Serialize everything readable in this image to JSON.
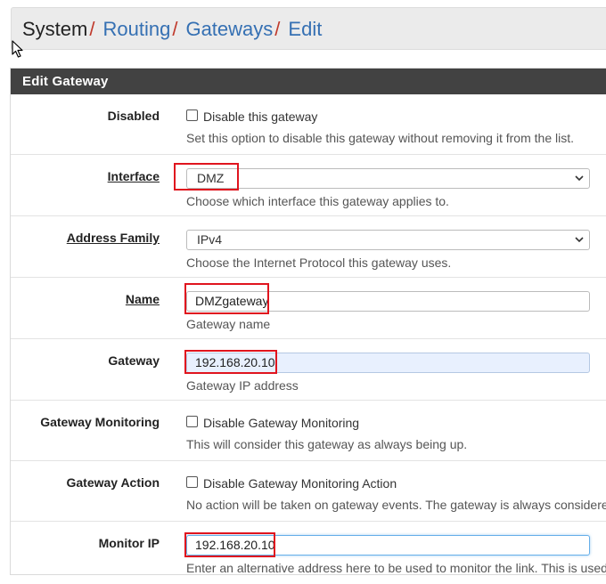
{
  "breadcrumb": {
    "items": [
      "System",
      "Routing",
      "Gateways",
      "Edit"
    ],
    "separator": "/"
  },
  "panel": {
    "title": "Edit Gateway"
  },
  "fields": {
    "disabled": {
      "label": "Disabled",
      "checkbox_label": "Disable this gateway",
      "checked": false,
      "help": "Set this option to disable this gateway without removing it from the list."
    },
    "interface": {
      "label": "Interface",
      "value": "DMZ",
      "help": "Choose which interface this gateway applies to."
    },
    "address_family": {
      "label": "Address Family",
      "value": "IPv4",
      "help": "Choose the Internet Protocol this gateway uses."
    },
    "name": {
      "label": "Name",
      "value": "DMZgateway",
      "help": "Gateway name"
    },
    "gateway": {
      "label": "Gateway",
      "value": "192.168.20.10",
      "help": "Gateway IP address"
    },
    "gateway_monitoring": {
      "label": "Gateway Monitoring",
      "checkbox_label": "Disable Gateway Monitoring",
      "checked": false,
      "help": "This will consider this gateway as always being up."
    },
    "gateway_action": {
      "label": "Gateway Action",
      "checkbox_label": "Disable Gateway Monitoring Action",
      "checked": false,
      "help": "No action will be taken on gateway events. The gateway is always considere"
    },
    "monitor_ip": {
      "label": "Monitor IP",
      "value": "192.168.20.10",
      "help": "Enter an alternative address here to be used to monitor the link. This is used"
    }
  },
  "colors": {
    "link": "#3570b3",
    "separator": "#c0392b",
    "panel_header": "#424242",
    "highlight": "#e0141e"
  },
  "icons": [
    "mouse-cursor-icon",
    "chevron-down-icon",
    "checkbox-icon"
  ]
}
